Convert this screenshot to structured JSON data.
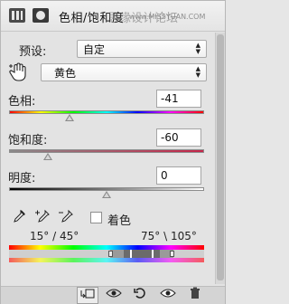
{
  "header": {
    "title": "色相/饱和度",
    "watermark": "思缘设计论坛",
    "watermark_url": "www.MISSYUAN.COM"
  },
  "preset": {
    "label": "预设:",
    "value": "自定"
  },
  "channel": {
    "value": "黄色"
  },
  "hue": {
    "label": "色相:",
    "value": "-41",
    "level_fraction": 0.31
  },
  "saturation": {
    "label": "饱和度:",
    "value": "-60",
    "level_fraction": 0.2
  },
  "lightness": {
    "label": "明度:",
    "value": "0",
    "level_fraction": 0.5
  },
  "colorize": {
    "label": "着色",
    "checked": false
  },
  "range": {
    "left": "15° / 45°",
    "right": "75° \\ 105°"
  },
  "footer_icons": [
    "clip-to-layer-icon",
    "view-previous-icon",
    "reset-icon",
    "visibility-icon",
    "delete-icon"
  ],
  "colors": {
    "panel_bg": "#e3e3e3",
    "input_bg": "#ffffff"
  }
}
